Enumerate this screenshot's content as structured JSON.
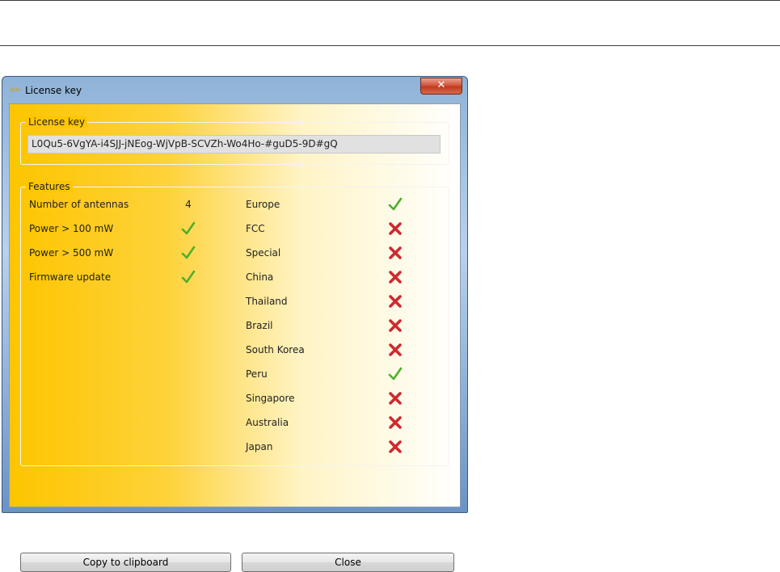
{
  "window": {
    "title": "License key",
    "close_glyph": "✕",
    "app_icon": "arrow-chevrons-icon"
  },
  "license_group": {
    "legend": "License key",
    "key": "L0Qu5-6VgYA-i4SJJ-jNEog-WjVpB-SCVZh-Wo4Ho-#guD5-9D#gQ"
  },
  "features_group": {
    "legend": "Features",
    "left": [
      {
        "label": "Number of antennas",
        "value": "4"
      },
      {
        "label": "Power > 100 mW",
        "status": "check"
      },
      {
        "label": "Power > 500 mW",
        "status": "check"
      },
      {
        "label": "Firmware update",
        "status": "check"
      }
    ],
    "regions": [
      {
        "label": "Europe",
        "status": "check"
      },
      {
        "label": "FCC",
        "status": "cross"
      },
      {
        "label": "Special",
        "status": "cross"
      },
      {
        "label": "China",
        "status": "cross"
      },
      {
        "label": "Thailand",
        "status": "cross"
      },
      {
        "label": "Brazil",
        "status": "cross"
      },
      {
        "label": "South Korea",
        "status": "cross"
      },
      {
        "label": "Peru",
        "status": "check"
      },
      {
        "label": "Singapore",
        "status": "cross"
      },
      {
        "label": "Australia",
        "status": "cross"
      },
      {
        "label": "Japan",
        "status": "cross"
      }
    ]
  },
  "buttons": {
    "copy_label": "Copy to clipboard",
    "close_label": "Close"
  },
  "colors": {
    "check": "#4fae2c",
    "cross": "#d0282f",
    "accent_yellow": "#fdc500"
  }
}
